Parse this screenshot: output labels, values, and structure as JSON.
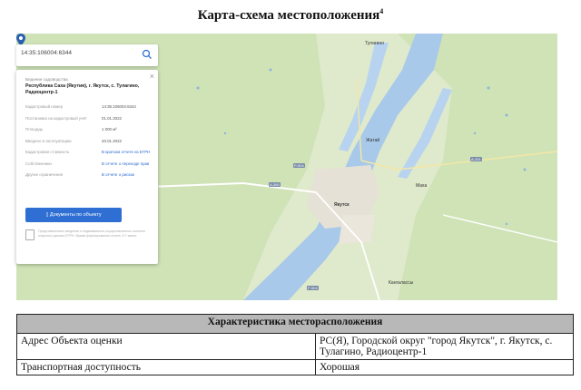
{
  "title": {
    "text": "Карта-схема местоположения",
    "footnote": "4"
  },
  "map": {
    "search_value": "14:35:106004:6344",
    "card": {
      "label": "Ведение садоводства",
      "address": "Республика Саха (Якутия), г. Якутск, с. Тулагино, Радиоцентр-1",
      "rows": [
        {
          "k": "Кадастровый номер",
          "v": "14:35:106004:6344",
          "link": false
        },
        {
          "k": "Постановка на кадастровый учёт",
          "v": "01.01.2022",
          "link": false
        },
        {
          "k": "Площадь",
          "v": "1 000 м²",
          "link": false
        },
        {
          "k": "Введено в эксплуатацию",
          "v": "20.01.2022",
          "link": false
        },
        {
          "k": "Кадастровая стоимость",
          "v": "В кратком отчете из ЕГРН",
          "link": true
        },
        {
          "k": "Собственники",
          "v": "В отчете о переходе прав",
          "link": true
        },
        {
          "k": "Другие ограничения",
          "v": "В отчете о рисках",
          "link": true
        }
      ],
      "docs_button": "Документы по объекту",
      "notice": "Представленные сведения о недвижимости осуществляются согласно открытых данных ЕГРН. Время формирования отчета: 5-7 минут."
    },
    "labels": {
      "yakutsk": "Якутск",
      "zhatay": "Жатай",
      "tulagino": "Тулагино",
      "kangalassy": "Кангалассы",
      "markha": "Маха"
    },
    "roads": [
      "Р-504",
      "А-331",
      "А-360",
      "Р-504"
    ],
    "colors": {
      "water": "#a9c9ea",
      "land": "#cfe3b7",
      "city": "#e6e1d6",
      "pin": "#2a5fb3"
    }
  },
  "table": {
    "header": "Характеристика месторасположения",
    "rows": [
      {
        "label": "Адрес Объекта оценки",
        "value": "РС(Я), Городской округ \"город Якутск\", г. Якутск, с. Тулагино, Радиоцентр-1"
      },
      {
        "label": "Транспортная доступность",
        "value": "Хорошая"
      }
    ]
  }
}
